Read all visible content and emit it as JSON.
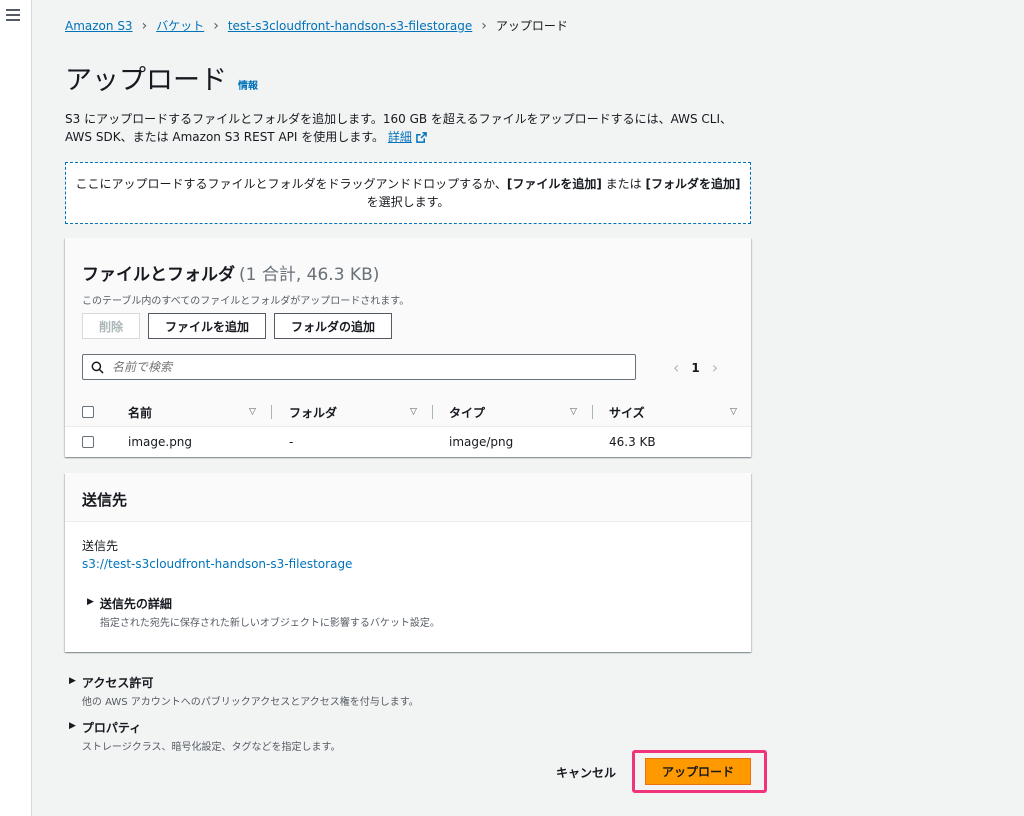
{
  "breadcrumb": {
    "items": [
      "Amazon S3",
      "バケット",
      "test-s3cloudfront-handson-s3-filestorage"
    ],
    "current": "アップロード"
  },
  "page": {
    "title": "アップロード",
    "info_label": "情報",
    "description_text": "S3 にアップロードするファイルとフォルダを追加します。160 GB を超えるファイルをアップロードするには、AWS CLI、AWS SDK、または Amazon S3 REST API を使用します。",
    "details_link": "詳細"
  },
  "dropzone": {
    "text_1": "ここにアップロードするファイルとフォルダをドラッグアンドドロップするか、",
    "add_files": "[ファイルを追加]",
    "or": " または ",
    "add_folder": "[フォルダを追加]",
    "text_2": "を選択します。"
  },
  "files_panel": {
    "title": "ファイルとフォルダ",
    "count": "(1 合計, 46.3 KB)",
    "subtitle": "このテーブル内のすべてのファイルとフォルダがアップロードされます。",
    "delete_label": "削除",
    "add_files_label": "ファイルを追加",
    "add_folder_label": "フォルダの追加",
    "search_placeholder": "名前で検索",
    "page_number": "1",
    "columns": [
      "名前",
      "フォルダ",
      "タイプ",
      "サイズ"
    ],
    "rows": [
      {
        "name": "image.png",
        "folder": "-",
        "type": "image/png",
        "size": "46.3 KB"
      }
    ]
  },
  "destination": {
    "header": "送信先",
    "label": "送信先",
    "uri": "s3://test-s3cloudfront-handson-s3-filestorage",
    "details_title": "送信先の詳細",
    "details_desc": "指定された宛先に保存された新しいオブジェクトに影響するバケット設定。"
  },
  "sections": {
    "access_title": "アクセス許可",
    "access_desc": "他の AWS アカウントへのパブリックアクセスとアクセス権を付与します。",
    "properties_title": "プロパティ",
    "properties_desc": "ストレージクラス、暗号化設定、タグなどを指定します。"
  },
  "actions": {
    "cancel_label": "キャンセル",
    "upload_label": "アップロード"
  },
  "colors": {
    "link": "#0073bb",
    "primary": "#ff9900",
    "highlight": "#f0337a"
  }
}
